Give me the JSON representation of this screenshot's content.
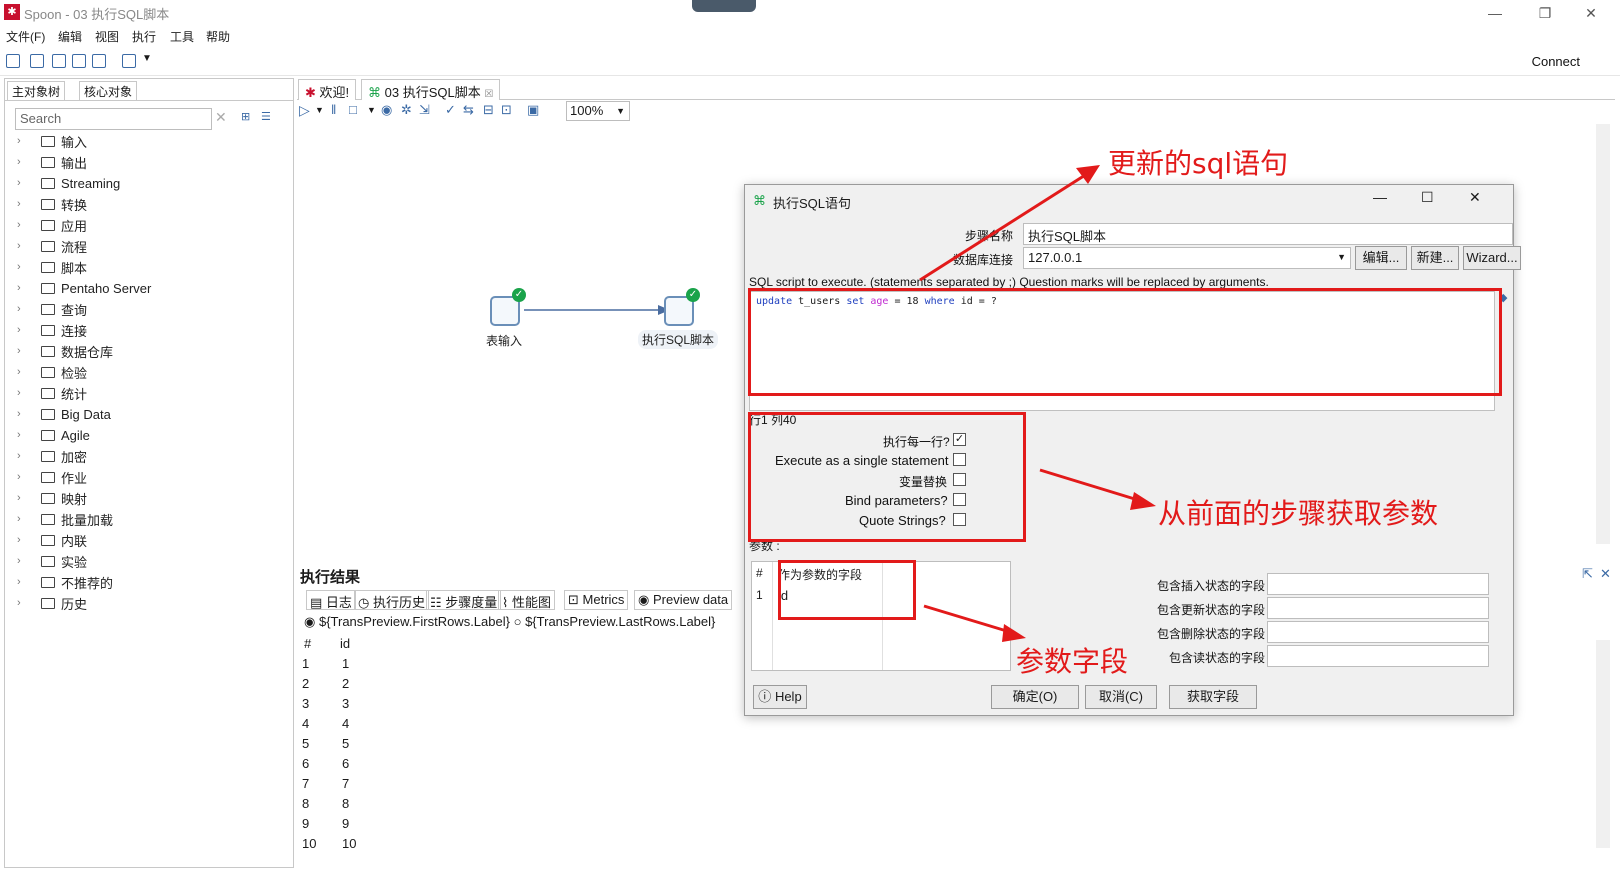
{
  "window": {
    "title": "Spoon - 03 执行SQL脚本",
    "minimize": "—",
    "maximize": "❐",
    "close": "✕"
  },
  "menu": [
    "文件(F)",
    "编辑",
    "视图",
    "执行",
    "工具",
    "帮助"
  ],
  "toolbar": {
    "connect": "Connect"
  },
  "left_panel": {
    "tabs": [
      "主对象树",
      "核心对象"
    ],
    "search_placeholder": "Search",
    "tree": [
      "输入",
      "输出",
      "Streaming",
      "转换",
      "应用",
      "流程",
      "脚本",
      "Pentaho Server",
      "查询",
      "连接",
      "数据仓库",
      "检验",
      "统计",
      "Big Data",
      "Agile",
      "加密",
      "作业",
      "映射",
      "批量加载",
      "内联",
      "实验",
      "不推荐的",
      "历史"
    ]
  },
  "center_tabs": [
    "欢迎!",
    "03 执行SQL脚本"
  ],
  "canvas": {
    "zoom": "100%",
    "steps": [
      {
        "label": "表输入"
      },
      {
        "label": "执行SQL脚本"
      }
    ]
  },
  "results": {
    "title": "执行结果",
    "tabs": [
      "日志",
      "执行历史",
      "步骤度量",
      "性能图",
      "Metrics",
      "Preview data"
    ],
    "radio_first": "${TransPreview.FirstRows.Label}",
    "radio_last": "${TransPreview.LastRows.Label}",
    "columns": [
      "#",
      "id"
    ],
    "rows": [
      [
        "1",
        "1"
      ],
      [
        "2",
        "2"
      ],
      [
        "3",
        "3"
      ],
      [
        "4",
        "4"
      ],
      [
        "5",
        "5"
      ],
      [
        "6",
        "6"
      ],
      [
        "7",
        "7"
      ],
      [
        "8",
        "8"
      ],
      [
        "9",
        "9"
      ],
      [
        "10",
        "10"
      ]
    ]
  },
  "dialog": {
    "title": "执行SQL语句",
    "step_name_label": "步骤名称",
    "step_name_value": "执行SQL脚本",
    "db_conn_label": "数据库连接",
    "db_conn_value": "127.0.0.1",
    "btn_edit": "编辑...",
    "btn_new": "新建...",
    "btn_wizard": "Wizard...",
    "sql_label": "SQL script to execute. (statements separated by ;) Question marks will be replaced by arguments.",
    "sql_parts": {
      "k1": "update",
      "t1": " t_users ",
      "k2": "set",
      "f1": " age",
      "t2": " = 18 ",
      "k3": "where",
      "t3": " id = ?"
    },
    "cursor_pos": "行1 列40",
    "options": [
      {
        "label": "执行每一行?",
        "checked": true
      },
      {
        "label": "Execute as a single statement",
        "checked": false
      },
      {
        "label": "变量替换",
        "checked": false
      },
      {
        "label": "Bind parameters?",
        "checked": false
      },
      {
        "label": "Quote Strings?",
        "checked": false
      }
    ],
    "params_label": "参数 :",
    "params_header": [
      "#",
      "作为参数的字段"
    ],
    "params_rows": [
      [
        "1",
        "id"
      ]
    ],
    "status_fields": [
      "包含插入状态的字段",
      "包含更新状态的字段",
      "包含删除状态的字段",
      "包含读状态的字段"
    ],
    "btn_help": "Help",
    "btn_ok": "确定(O)",
    "btn_cancel": "取消(C)",
    "btn_getfields": "获取字段"
  },
  "annotations": {
    "sql": "更新的sql语句",
    "params_from_prev": "从前面的步骤获取参数",
    "param_field": "参数字段"
  },
  "colors": {
    "annotation_red": "#e21a1a",
    "check_green": "#1aa34a",
    "app_red": "#c8102e"
  }
}
